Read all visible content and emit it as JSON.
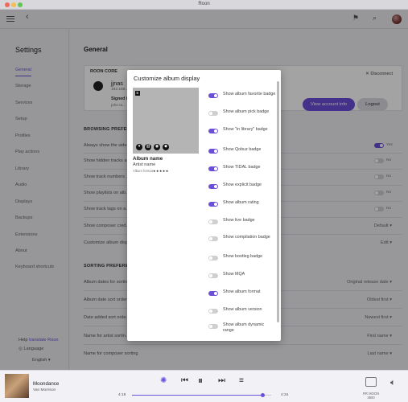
{
  "window": {
    "title": "Roon"
  },
  "sidebar": {
    "title": "Settings",
    "items": [
      {
        "label": "General",
        "active": true
      },
      {
        "label": "Storage"
      },
      {
        "label": "Services"
      },
      {
        "label": "Setup"
      },
      {
        "label": "Profiles"
      },
      {
        "label": "Play actions"
      },
      {
        "label": "Library"
      },
      {
        "label": "Audio"
      },
      {
        "label": "Displays"
      },
      {
        "label": "Backups"
      },
      {
        "label": "Extensions"
      },
      {
        "label": "About"
      },
      {
        "label": "Keyboard shortcuts"
      }
    ],
    "help_prefix": "Help",
    "help_link": "translate Roon",
    "language_label": "Language",
    "language_value": "English"
  },
  "main": {
    "title": "General",
    "core": {
      "section": "ROON CORE",
      "name": "jjnas",
      "ip": "192.168...",
      "signed_in": "Signed i...",
      "email": "john.tu...",
      "disconnect": "Disconnect",
      "view_account": "View account info",
      "logout": "Logout"
    },
    "browsing_section": "BROWSING PREFERE...",
    "browsing_rows": [
      {
        "label": "Always show the side...",
        "toggle": true,
        "value": "Yes"
      },
      {
        "label": "Show hidden tracks a...",
        "toggle": false,
        "value": "No"
      },
      {
        "label": "Show track numbers ...",
        "toggle": false,
        "value": "No"
      },
      {
        "label": "Show playlists on alb...",
        "toggle": false,
        "value": "No"
      },
      {
        "label": "Show track tags on a...",
        "toggle": false,
        "value": "No"
      },
      {
        "label": "Show composer cred...",
        "value": "Default"
      },
      {
        "label": "Customize album disp...",
        "value": "Edit"
      }
    ],
    "sorting_section": "SORTING PREFEREN...",
    "sorting_rows": [
      {
        "label": "Album dates for sortin...",
        "value": "Original release date"
      },
      {
        "label": "Album date sort order",
        "value": "Oldest first"
      },
      {
        "label": "Date added sort orde...",
        "value": "Newest first"
      },
      {
        "label": "Name for artist sortin...",
        "value": "First name"
      },
      {
        "label": "Name for composer sorting",
        "value": "Last name"
      }
    ]
  },
  "modal": {
    "title": "Customize album display",
    "album_name": "Album name",
    "artist_name": "Artist name",
    "album_format": "Album format",
    "stars": "★★★★★",
    "badge_letter": "E",
    "options": [
      {
        "label": "Show album favorite badge",
        "on": true
      },
      {
        "label": "Show album pick badge",
        "on": false
      },
      {
        "label": "Show \"in library\" badge",
        "on": true
      },
      {
        "label": "Show Qobuz badge",
        "on": true
      },
      {
        "label": "Show TIDAL badge",
        "on": true
      },
      {
        "label": "Show explicit badge",
        "on": true
      },
      {
        "label": "Show album rating",
        "on": true
      },
      {
        "label": "Show live badge",
        "on": false
      },
      {
        "label": "Show compilation badge",
        "on": false
      },
      {
        "label": "Show bootleg badge",
        "on": false
      },
      {
        "label": "Show MQA",
        "on": false
      },
      {
        "label": "Show album format",
        "on": true
      },
      {
        "label": "Show album version",
        "on": false
      },
      {
        "label": "Show album dynamic range",
        "on": false
      }
    ]
  },
  "player": {
    "title": "Moondance",
    "artist": "Van Morrison",
    "elapsed": "4:18",
    "total": "4:34",
    "progress": 0.94,
    "zone": "RR MOON 3800"
  },
  "colors": {
    "accent": "#6b4fd8"
  }
}
